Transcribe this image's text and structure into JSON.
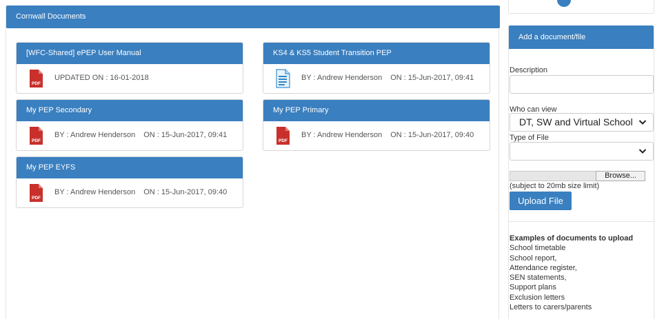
{
  "main": {
    "header": "Cornwall Documents",
    "documents": [
      {
        "title": "[WFC-Shared] ePEP User Manual",
        "icon": "pdf-icon",
        "meta": "UPDATED ON : 16-01-2018",
        "by": "",
        "on": ""
      },
      {
        "title": "KS4 & KS5 Student Transition PEP",
        "icon": "doc-icon",
        "meta": "",
        "by": "BY : Andrew Henderson",
        "on": "ON : 15-Jun-2017, 09:41"
      },
      {
        "title": "My PEP Secondary",
        "icon": "pdf-icon",
        "meta": "",
        "by": "BY : Andrew Henderson",
        "on": "ON : 15-Jun-2017, 09:41"
      },
      {
        "title": "My PEP Primary",
        "icon": "pdf-icon",
        "meta": "",
        "by": "BY : Andrew Henderson",
        "on": "ON : 15-Jun-2017, 09:40"
      },
      {
        "title": "My PEP EYFS",
        "icon": "pdf-icon",
        "meta": "",
        "by": "BY : Andrew Henderson",
        "on": "ON : 15-Jun-2017, 09:40"
      }
    ]
  },
  "sidebar": {
    "header": "Add a document/file",
    "description_label": "Description",
    "description_value": "",
    "who_label": "Who can view",
    "who_value": "DT, SW and Virtual School",
    "type_label": "Type of File",
    "type_value": "",
    "browse_label": "Browse...",
    "size_note": "(subject to 20mb size limit)",
    "upload_label": "Upload File",
    "examples_title": "Examples of documents to upload",
    "examples": [
      "School timetable",
      "School report,",
      "Attendance register,",
      "SEN statements,",
      "Support plans",
      "Exclusion letters",
      "Letters to carers/parents"
    ]
  },
  "colors": {
    "accent": "#3a7fbf",
    "pdf_red": "#c9302c"
  }
}
